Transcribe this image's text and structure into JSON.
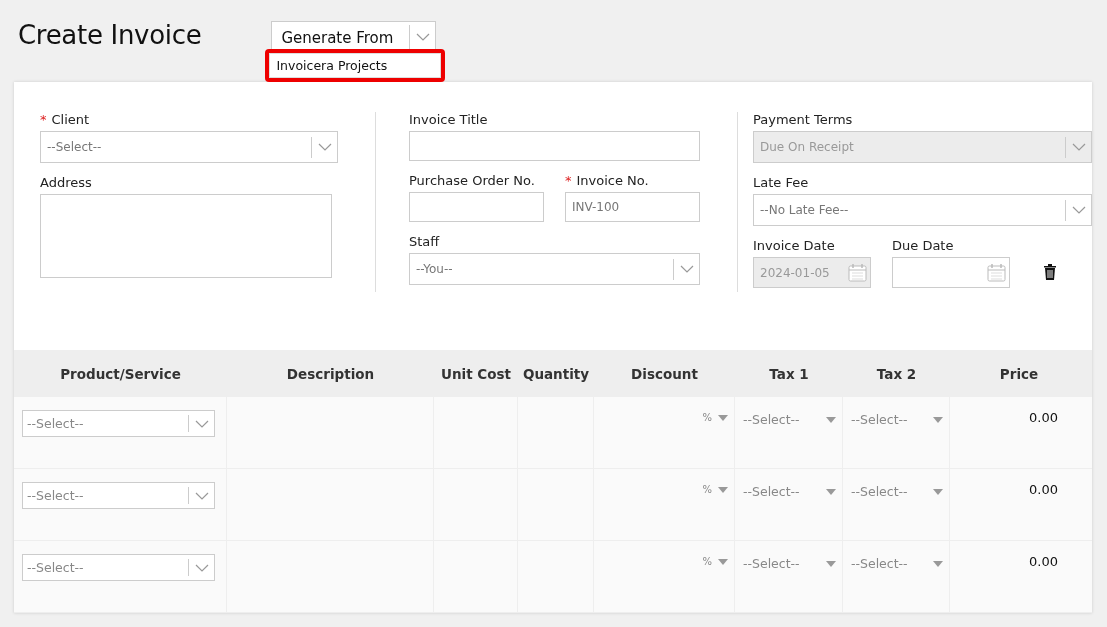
{
  "page_title": "Create Invoice",
  "generate_from": {
    "label": "Generate From",
    "options": [
      {
        "label": "Invoicera Projects",
        "highlighted": true
      }
    ]
  },
  "form": {
    "columns": [
      [
        [
          {
            "kind": "select",
            "label": "Client",
            "required_mark": "*",
            "placeholder": "--Select--"
          }
        ],
        [
          {
            "kind": "textarea",
            "label": "Address"
          }
        ]
      ],
      [
        [
          {
            "kind": "text",
            "label": "Invoice Title"
          }
        ],
        [
          {
            "kind": "text",
            "label": "Purchase Order No."
          },
          {
            "kind": "text",
            "label": "Invoice No.",
            "required_mark": "*",
            "placeholder": "INV-100"
          }
        ],
        [
          {
            "kind": "select",
            "label": "Staff",
            "placeholder": "--You--"
          }
        ]
      ],
      [
        [
          {
            "kind": "select",
            "label": "Payment Terms",
            "value": "Due On Receipt",
            "disabled": true
          }
        ],
        [
          {
            "kind": "select",
            "label": "Late Fee",
            "value": "--No Late Fee--"
          }
        ],
        [
          {
            "kind": "date",
            "label": "Invoice Date",
            "value": "2024-01-05",
            "disabled": true
          },
          {
            "kind": "date",
            "label": "Due Date",
            "deletable": true
          }
        ]
      ]
    ]
  },
  "table": {
    "columns": [
      "Product/Service",
      "Description",
      "Unit Cost",
      "Quantity",
      "Discount",
      "Tax 1",
      "Tax 2",
      "Price"
    ],
    "rows": [
      {
        "product": "--Select--",
        "discount_unit": "%",
        "tax_1": "--Select--",
        "tax_2": "--Select--",
        "price": "0.00"
      },
      {
        "product": "--Select--",
        "discount_unit": "%",
        "tax_1": "--Select--",
        "tax_2": "--Select--",
        "price": "0.00"
      },
      {
        "product": "--Select--",
        "discount_unit": "%",
        "tax_1": "--Select--",
        "tax_2": "--Select--",
        "price": "0.00"
      }
    ]
  }
}
